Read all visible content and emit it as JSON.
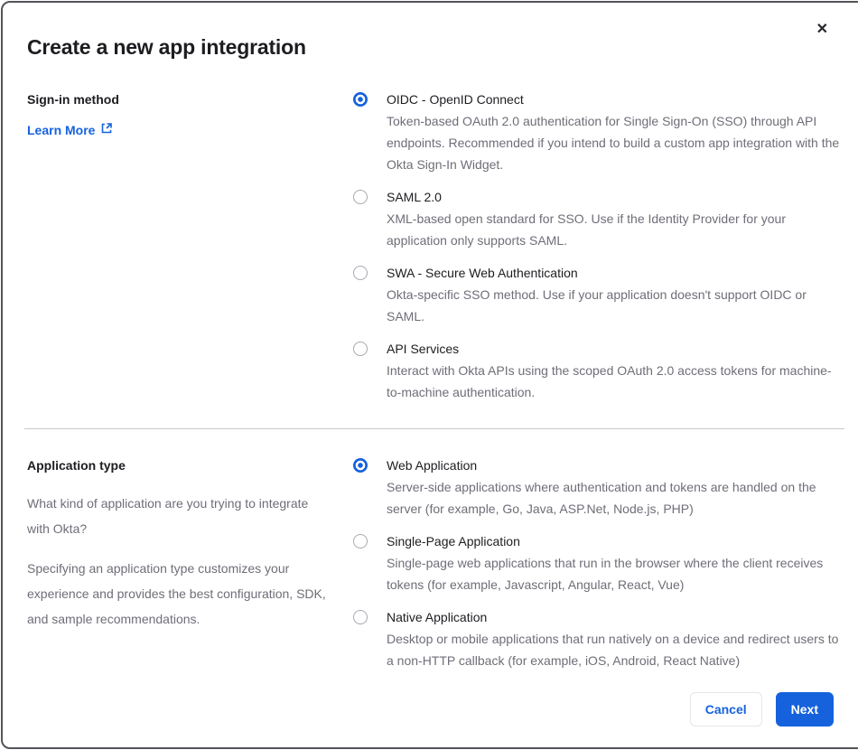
{
  "modal": {
    "title": "Create a new app integration"
  },
  "icons": {
    "close": "✕"
  },
  "signin_section": {
    "label": "Sign-in method",
    "learn_more_label": "Learn More",
    "options": [
      {
        "label": "OIDC - OpenID Connect",
        "description": "Token-based OAuth 2.0 authentication for Single Sign-On (SSO) through API endpoints. Recommended if you intend to build a custom app integration with the Okta Sign-In Widget.",
        "selected": true
      },
      {
        "label": "SAML 2.0",
        "description": "XML-based open standard for SSO. Use if the Identity Provider for your application only supports SAML.",
        "selected": false
      },
      {
        "label": "SWA - Secure Web Authentication",
        "description": "Okta-specific SSO method. Use if your application doesn't support OIDC or SAML.",
        "selected": false
      },
      {
        "label": "API Services",
        "description": "Interact with Okta APIs using the scoped OAuth 2.0 access tokens for machine-to-machine authentication.",
        "selected": false
      }
    ]
  },
  "apptype_section": {
    "label": "Application type",
    "question": "What kind of application are you trying to integrate with Okta?",
    "note": "Specifying an application type customizes your experience and provides the best configuration, SDK, and sample recommendations.",
    "options": [
      {
        "label": "Web Application",
        "description": "Server-side applications where authentication and tokens are handled on the server (for example, Go, Java, ASP.Net, Node.js, PHP)",
        "selected": true
      },
      {
        "label": "Single-Page Application",
        "description": "Single-page web applications that run in the browser where the client receives tokens (for example, Javascript, Angular, React, Vue)",
        "selected": false
      },
      {
        "label": "Native Application",
        "description": "Desktop or mobile applications that run natively on a device and redirect users to a non-HTTP callback (for example, iOS, Android, React Native)",
        "selected": false
      }
    ]
  },
  "footer": {
    "cancel_label": "Cancel",
    "next_label": "Next"
  },
  "colors": {
    "accent_blue": "#1662dd",
    "text_dark": "#1d1d21",
    "text_gray": "#6e6e78",
    "border_dark": "#54545a",
    "divider_gray": "#c9c9ce"
  }
}
